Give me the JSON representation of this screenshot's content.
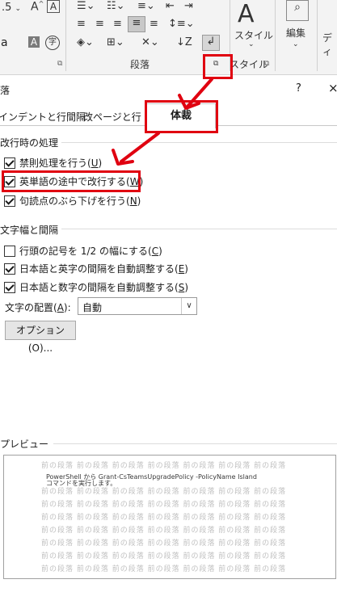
{
  "ribbon": {
    "font_size_value": ".5",
    "group_paragraph_label": "段落",
    "style_button_label": "スタイル",
    "style_group_label": "スタイル",
    "edit_label": "編集",
    "right_cut_label": "ディ"
  },
  "dialog": {
    "title": "落",
    "help": "?",
    "close": "×",
    "tabs": [
      {
        "label": "インデントと行間隔"
      },
      {
        "label": "改ページと行"
      },
      {
        "label": "体裁"
      }
    ],
    "section_linebreak": "改行時の処理",
    "cb_kinsoku": {
      "label": "禁則処理を行う(",
      "key": "U",
      "end": ")",
      "checked": true
    },
    "cb_wordwrap": {
      "label": "英単語の途中で改行する(",
      "key": "W",
      "end": ")",
      "checked": true
    },
    "cb_hanging": {
      "label": "句読点のぶら下げを行う(",
      "key": "N",
      "end": ")",
      "checked": true
    },
    "section_width": "文字幅と間隔",
    "cb_halfwidth": {
      "label": "行頭の記号を 1/2 の幅にする(",
      "key": "C",
      "end": ")",
      "checked": false
    },
    "cb_en_space": {
      "label": "日本語と英字の間隔を自動調整する(",
      "key": "E",
      "end": ")",
      "checked": true
    },
    "cb_num_space": {
      "label": "日本語と数字の間隔を自動調整する(",
      "key": "S",
      "end": ")",
      "checked": true
    },
    "align_label": "文字の配置(",
    "align_key": "A",
    "align_end": "):",
    "align_value": "自動",
    "options_button": "オプション(O)...",
    "section_preview": "プレビュー",
    "preview_grey_line": "前の段落 前の段落 前の段落 前の段落 前の段落 前の段落 前の段落",
    "preview_text_1": "PowerShell から Grant-CsTeamsUpgradePolicy -PolicyName Island",
    "preview_text_2": "コマンドを実行します。"
  },
  "colors": {
    "annotation_red": "#e00010"
  }
}
